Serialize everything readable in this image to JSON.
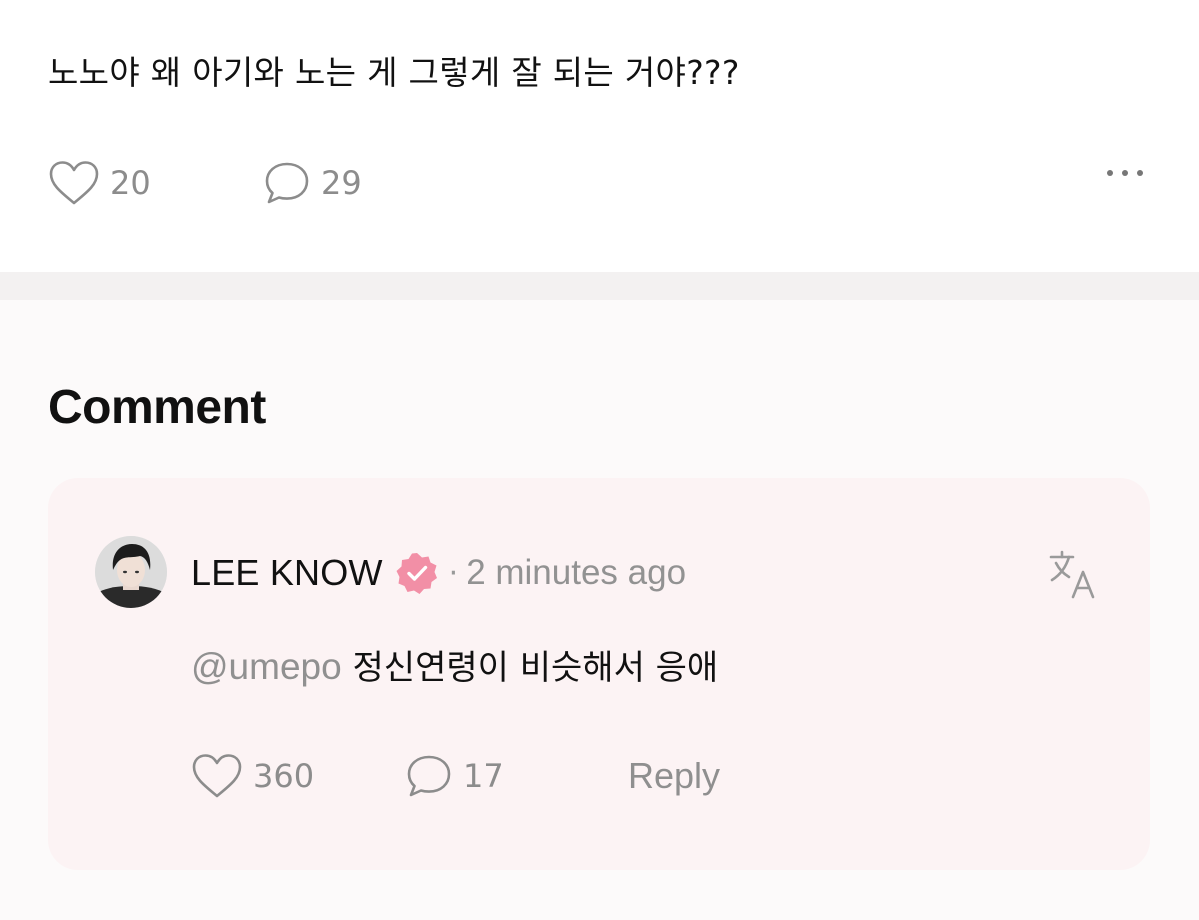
{
  "post": {
    "text": "노노야 왜 아기와 노는 게 그렇게 잘 되는 거야???",
    "like_count": "20",
    "comment_count": "29",
    "more_icon": "more-horizontal-icon"
  },
  "comments_section": {
    "title": "Comment",
    "comments": [
      {
        "author": "LEE KNOW",
        "verified_icon": "verified-badge-icon",
        "separator": "·",
        "time": "2 minutes ago",
        "translate_icon": "translate-icon",
        "mention": "@umepo",
        "text": "정신연령이 비슷해서 응애",
        "like_count": "360",
        "reply_count": "17",
        "reply_label": "Reply"
      }
    ]
  },
  "colors": {
    "card_background": "#fcf3f4",
    "verified_badge": "#f28fa6",
    "muted_text": "#8c8c8c"
  }
}
